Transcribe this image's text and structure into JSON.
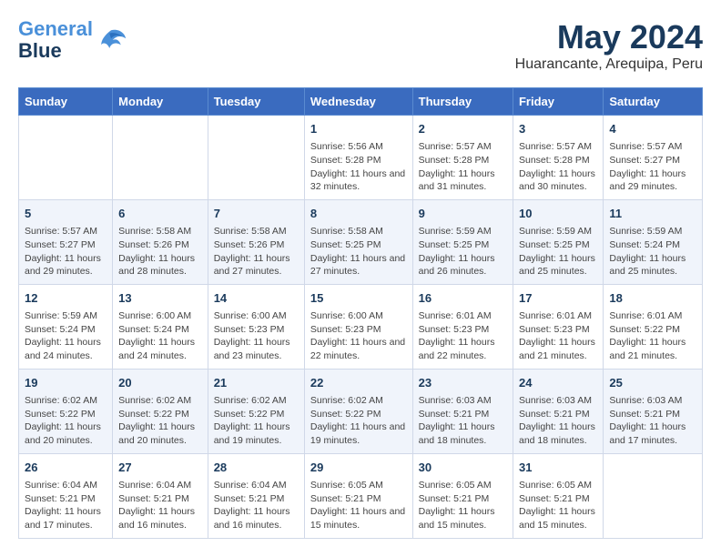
{
  "header": {
    "logo_line1": "General",
    "logo_line2": "Blue",
    "title": "May 2024",
    "subtitle": "Huarancante, Arequipa, Peru"
  },
  "days_of_week": [
    "Sunday",
    "Monday",
    "Tuesday",
    "Wednesday",
    "Thursday",
    "Friday",
    "Saturday"
  ],
  "weeks": [
    [
      {
        "day": "",
        "info": ""
      },
      {
        "day": "",
        "info": ""
      },
      {
        "day": "",
        "info": ""
      },
      {
        "day": "1",
        "info": "Sunrise: 5:56 AM\nSunset: 5:28 PM\nDaylight: 11 hours and 32 minutes."
      },
      {
        "day": "2",
        "info": "Sunrise: 5:57 AM\nSunset: 5:28 PM\nDaylight: 11 hours and 31 minutes."
      },
      {
        "day": "3",
        "info": "Sunrise: 5:57 AM\nSunset: 5:28 PM\nDaylight: 11 hours and 30 minutes."
      },
      {
        "day": "4",
        "info": "Sunrise: 5:57 AM\nSunset: 5:27 PM\nDaylight: 11 hours and 29 minutes."
      }
    ],
    [
      {
        "day": "5",
        "info": "Sunrise: 5:57 AM\nSunset: 5:27 PM\nDaylight: 11 hours and 29 minutes."
      },
      {
        "day": "6",
        "info": "Sunrise: 5:58 AM\nSunset: 5:26 PM\nDaylight: 11 hours and 28 minutes."
      },
      {
        "day": "7",
        "info": "Sunrise: 5:58 AM\nSunset: 5:26 PM\nDaylight: 11 hours and 27 minutes."
      },
      {
        "day": "8",
        "info": "Sunrise: 5:58 AM\nSunset: 5:25 PM\nDaylight: 11 hours and 27 minutes."
      },
      {
        "day": "9",
        "info": "Sunrise: 5:59 AM\nSunset: 5:25 PM\nDaylight: 11 hours and 26 minutes."
      },
      {
        "day": "10",
        "info": "Sunrise: 5:59 AM\nSunset: 5:25 PM\nDaylight: 11 hours and 25 minutes."
      },
      {
        "day": "11",
        "info": "Sunrise: 5:59 AM\nSunset: 5:24 PM\nDaylight: 11 hours and 25 minutes."
      }
    ],
    [
      {
        "day": "12",
        "info": "Sunrise: 5:59 AM\nSunset: 5:24 PM\nDaylight: 11 hours and 24 minutes."
      },
      {
        "day": "13",
        "info": "Sunrise: 6:00 AM\nSunset: 5:24 PM\nDaylight: 11 hours and 24 minutes."
      },
      {
        "day": "14",
        "info": "Sunrise: 6:00 AM\nSunset: 5:23 PM\nDaylight: 11 hours and 23 minutes."
      },
      {
        "day": "15",
        "info": "Sunrise: 6:00 AM\nSunset: 5:23 PM\nDaylight: 11 hours and 22 minutes."
      },
      {
        "day": "16",
        "info": "Sunrise: 6:01 AM\nSunset: 5:23 PM\nDaylight: 11 hours and 22 minutes."
      },
      {
        "day": "17",
        "info": "Sunrise: 6:01 AM\nSunset: 5:23 PM\nDaylight: 11 hours and 21 minutes."
      },
      {
        "day": "18",
        "info": "Sunrise: 6:01 AM\nSunset: 5:22 PM\nDaylight: 11 hours and 21 minutes."
      }
    ],
    [
      {
        "day": "19",
        "info": "Sunrise: 6:02 AM\nSunset: 5:22 PM\nDaylight: 11 hours and 20 minutes."
      },
      {
        "day": "20",
        "info": "Sunrise: 6:02 AM\nSunset: 5:22 PM\nDaylight: 11 hours and 20 minutes."
      },
      {
        "day": "21",
        "info": "Sunrise: 6:02 AM\nSunset: 5:22 PM\nDaylight: 11 hours and 19 minutes."
      },
      {
        "day": "22",
        "info": "Sunrise: 6:02 AM\nSunset: 5:22 PM\nDaylight: 11 hours and 19 minutes."
      },
      {
        "day": "23",
        "info": "Sunrise: 6:03 AM\nSunset: 5:21 PM\nDaylight: 11 hours and 18 minutes."
      },
      {
        "day": "24",
        "info": "Sunrise: 6:03 AM\nSunset: 5:21 PM\nDaylight: 11 hours and 18 minutes."
      },
      {
        "day": "25",
        "info": "Sunrise: 6:03 AM\nSunset: 5:21 PM\nDaylight: 11 hours and 17 minutes."
      }
    ],
    [
      {
        "day": "26",
        "info": "Sunrise: 6:04 AM\nSunset: 5:21 PM\nDaylight: 11 hours and 17 minutes."
      },
      {
        "day": "27",
        "info": "Sunrise: 6:04 AM\nSunset: 5:21 PM\nDaylight: 11 hours and 16 minutes."
      },
      {
        "day": "28",
        "info": "Sunrise: 6:04 AM\nSunset: 5:21 PM\nDaylight: 11 hours and 16 minutes."
      },
      {
        "day": "29",
        "info": "Sunrise: 6:05 AM\nSunset: 5:21 PM\nDaylight: 11 hours and 15 minutes."
      },
      {
        "day": "30",
        "info": "Sunrise: 6:05 AM\nSunset: 5:21 PM\nDaylight: 11 hours and 15 minutes."
      },
      {
        "day": "31",
        "info": "Sunrise: 6:05 AM\nSunset: 5:21 PM\nDaylight: 11 hours and 15 minutes."
      },
      {
        "day": "",
        "info": ""
      }
    ]
  ]
}
